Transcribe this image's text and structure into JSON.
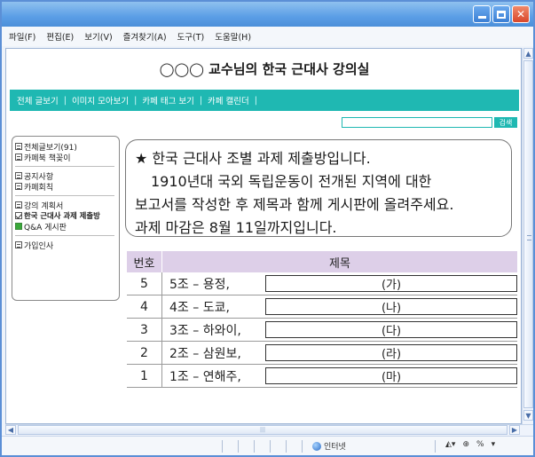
{
  "window": {
    "menu": [
      "파일(F)",
      "편집(E)",
      "보기(V)",
      "즐겨찾기(A)",
      "도구(T)",
      "도움말(H)"
    ]
  },
  "blog": {
    "title": "◯◯◯ 교수님의 한국 근대사 강의실",
    "nav": [
      "전체 글보기",
      "이미지 모아보기",
      "카페 태그 보기",
      "카페 캘린더"
    ],
    "search_button": "검색",
    "search_placeholder": ""
  },
  "sidebar": {
    "groups": [
      {
        "items": [
          {
            "icon": "board-icon",
            "label": "전체글보기(91)"
          },
          {
            "icon": "board-icon",
            "label": "카페북 책꽂이"
          }
        ]
      },
      {
        "items": [
          {
            "icon": "board-icon",
            "label": "공지사항"
          },
          {
            "icon": "board-icon",
            "label": "카페회칙"
          }
        ]
      },
      {
        "items": [
          {
            "icon": "board-icon",
            "label": "강의 계획서"
          },
          {
            "icon": "check-icon",
            "label": "한국 근대사 과제 제출방"
          },
          {
            "icon": "bbs-icon",
            "label": "Q&A 게시판"
          }
        ]
      },
      {
        "items": [
          {
            "icon": "board-icon",
            "label": "가입인사"
          }
        ]
      }
    ]
  },
  "notice": {
    "line1": "★ 한국 근대사 조별 과제 제출방입니다.",
    "line2": "1910년대 국외 독립운동이 전개된 지역에 대한",
    "line3": "보고서를 작성한 후 제목과 함께 게시판에 올려주세요.",
    "line4": "과제 마감은 8월 11일까지입니다."
  },
  "table": {
    "header_no": "번호",
    "header_title": "제목",
    "rows": [
      {
        "no": "5",
        "title": "5조 – 용정,",
        "blank": "(가)"
      },
      {
        "no": "4",
        "title": "4조 – 도쿄,",
        "blank": "(나)"
      },
      {
        "no": "3",
        "title": "3조 – 하와이,",
        "blank": "(다)"
      },
      {
        "no": "2",
        "title": "2조 – 삼원보,",
        "blank": "(라)"
      },
      {
        "no": "1",
        "title": "1조 – 연해주,",
        "blank": "(마)"
      }
    ]
  },
  "status": {
    "zone": "인터넷",
    "zoom": "%"
  }
}
